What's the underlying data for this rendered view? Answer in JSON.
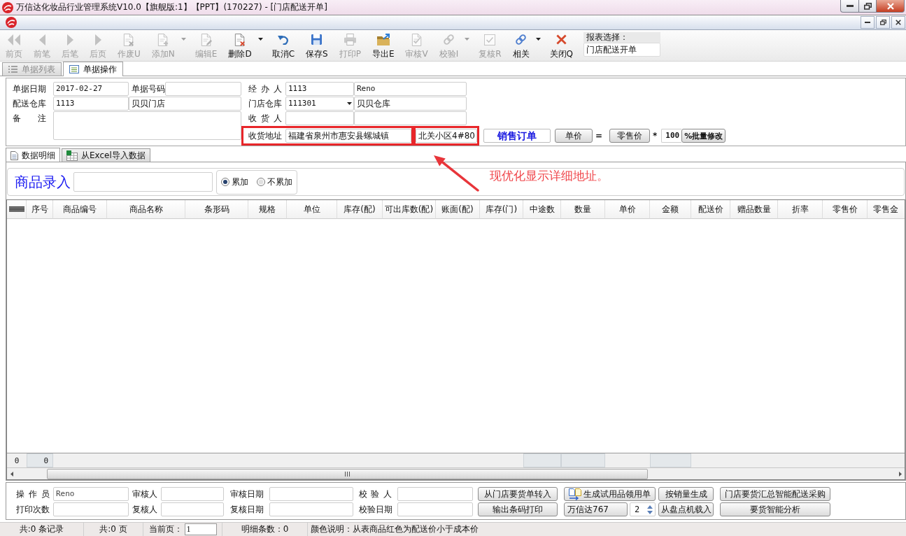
{
  "window": {
    "title": "万信达化妆品行业管理系统V10.0【旗舰版:1】【PPT】(170227) - [门店配送开单]"
  },
  "toolbar": {
    "buttons": [
      {
        "label": "前页",
        "disabled": true,
        "dropdown": false
      },
      {
        "label": "前笔",
        "disabled": true,
        "dropdown": false
      },
      {
        "label": "后笔",
        "disabled": true,
        "dropdown": false
      },
      {
        "label": "后页",
        "disabled": true,
        "dropdown": false
      },
      {
        "label": "作废U",
        "disabled": true,
        "dropdown": false
      },
      {
        "label": "添加N",
        "disabled": true,
        "dropdown": true
      },
      {
        "label": "编辑E",
        "disabled": true,
        "dropdown": false
      },
      {
        "label": "删除D",
        "disabled": false,
        "dropdown": true
      },
      {
        "label": "取消C",
        "disabled": false,
        "dropdown": false
      },
      {
        "label": "保存S",
        "disabled": false,
        "dropdown": false
      },
      {
        "label": "打印P",
        "disabled": true,
        "dropdown": false
      },
      {
        "label": "导出E",
        "disabled": false,
        "dropdown": false
      },
      {
        "label": "审核V",
        "disabled": true,
        "dropdown": false
      },
      {
        "label": "校验I",
        "disabled": true,
        "dropdown": true
      },
      {
        "label": "复核R",
        "disabled": true,
        "dropdown": false
      },
      {
        "label": "相关",
        "disabled": false,
        "dropdown": true
      },
      {
        "label": "关闭Q",
        "disabled": false,
        "dropdown": false
      }
    ],
    "report_select": {
      "label": "报表选择：",
      "value": "门店配送开单"
    }
  },
  "doc_tabs": [
    {
      "label": "单据列表",
      "selected": false
    },
    {
      "label": "单据操作",
      "selected": true
    }
  ],
  "order_form": {
    "doc_date": {
      "label": "单据日期",
      "value": "2017-02-27"
    },
    "doc_no": {
      "label": "单据号码"
    },
    "warehouse": {
      "label": "配送仓库",
      "code": "1113",
      "name": "贝贝门店"
    },
    "note": {
      "label": "备 注"
    },
    "handler": {
      "label": "经 办 人",
      "code": "1113",
      "name": "Reno"
    },
    "store_warehouse": {
      "label": "门店仓库",
      "code": "111301",
      "name": "贝贝仓库"
    },
    "receiver": {
      "label": "收 货 人"
    },
    "address": {
      "label": "收货地址",
      "value": "福建省泉州市惠安县螺城镇",
      "detail": "北关小区4#80",
      "highlighted": true
    },
    "order_type": "销售订单",
    "price_rule": {
      "base_button": "单价",
      "equals": "=",
      "source_button": "零售价",
      "times": "*",
      "percent": "100",
      "apply_button": "%批量修改"
    }
  },
  "annotation": {
    "text": "现优化显示详细地址。"
  },
  "detail_tabs": [
    {
      "label": "数据明细",
      "selected": true
    },
    {
      "label": "从Excel导入数据",
      "selected": false
    }
  ],
  "entry": {
    "label": "商品录入",
    "modes": [
      {
        "label": "累加",
        "selected": true
      },
      {
        "label": "不累加",
        "selected": false
      }
    ]
  },
  "table": {
    "columns": [
      {
        "kind": "menu"
      },
      {
        "kind": "text",
        "label": "序号"
      },
      {
        "kind": "text",
        "label": "商品编号"
      },
      {
        "kind": "text",
        "label": "商品名称"
      },
      {
        "kind": "text",
        "label": "条形码"
      },
      {
        "kind": "text",
        "label": "规格"
      },
      {
        "kind": "text",
        "label": "单位"
      },
      {
        "kind": "text",
        "label": "库存(配)"
      },
      {
        "kind": "text",
        "label": "可出库数(配)"
      },
      {
        "kind": "text",
        "label": "账面(配)"
      },
      {
        "kind": "text",
        "label": "库存(门)"
      },
      {
        "kind": "text",
        "label": "中途数"
      },
      {
        "kind": "text",
        "label": "数量"
      },
      {
        "kind": "text",
        "label": "单价"
      },
      {
        "kind": "text",
        "label": "金额"
      },
      {
        "kind": "text",
        "label": "配送价"
      },
      {
        "kind": "text",
        "label": "赠品数量"
      },
      {
        "kind": "text",
        "label": "折率"
      },
      {
        "kind": "text",
        "label": "零售价"
      },
      {
        "kind": "text",
        "label": "零售金"
      }
    ],
    "footer": [
      {
        "kind": "count",
        "value": "0"
      },
      {
        "kind": "total",
        "value": "0"
      },
      {
        "kind": "blank"
      },
      {
        "kind": "blank"
      },
      {
        "kind": "blank"
      },
      {
        "kind": "blank"
      },
      {
        "kind": "blank"
      },
      {
        "kind": "blank"
      },
      {
        "kind": "blank"
      },
      {
        "kind": "blank"
      },
      {
        "kind": "blank"
      },
      {
        "kind": "total"
      },
      {
        "kind": "total"
      },
      {
        "kind": "blank"
      },
      {
        "kind": "total"
      },
      {
        "kind": "blank"
      },
      {
        "kind": "blank"
      },
      {
        "kind": "blank"
      },
      {
        "kind": "blank"
      },
      {
        "kind": "blank"
      }
    ]
  },
  "audit_form": {
    "operator": {
      "label": "操 作 员",
      "value": "Reno"
    },
    "auditor": {
      "label": "审核人"
    },
    "audit_date": {
      "label": "审核日期"
    },
    "verifier": {
      "label": "校 验 人"
    },
    "print_count": {
      "label": "打印次数"
    },
    "reviewer": {
      "label": "复核人"
    },
    "review_date": {
      "label": "复核日期"
    },
    "verify_date": {
      "label": "校验日期"
    }
  },
  "actions": {
    "import_request": "从门店要货单转入",
    "trial_slip": "生成试用品领用单",
    "by_sales": "按销量生成",
    "smart_purchase": "门店要货汇总智能配送采购",
    "barcode_print": "输出条码打印",
    "template": "万信达767",
    "copies": "2",
    "from_scanner": "从盘点机载入",
    "smart_analysis": "要货智能分析"
  },
  "status_bar": {
    "records": "共:0 条记录",
    "pages": "共:0 页",
    "page_label": "当前页：",
    "page": "1",
    "detail_count": "明细条数：0",
    "legend": "颜色说明：从表商品红色为配送价小于成本价"
  }
}
